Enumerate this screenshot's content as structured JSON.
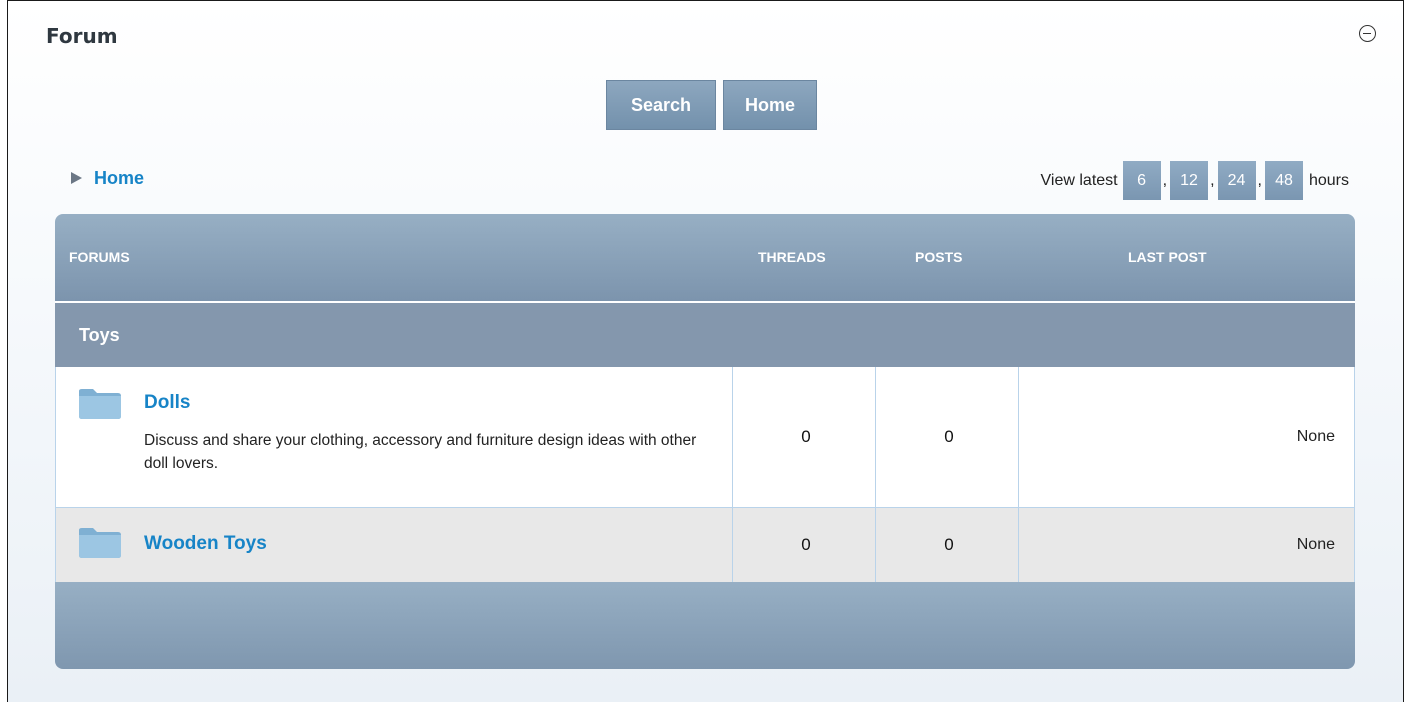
{
  "module": {
    "title": "Forum"
  },
  "nav": {
    "search_label": "Search",
    "home_label": "Home"
  },
  "breadcrumb": {
    "home": "Home"
  },
  "view_latest": {
    "label_before": "View latest",
    "label_after": "hours",
    "options": [
      "6",
      "12",
      "24",
      "48"
    ],
    "separator": ","
  },
  "table": {
    "headers": {
      "forums": "FORUMS",
      "threads": "THREADS",
      "posts": "POSTS",
      "last_post": "LAST POST"
    },
    "category": "Toys",
    "rows": [
      {
        "name": "Dolls",
        "description": "Discuss and share your clothing, accessory and furniture design ideas with other doll lovers.",
        "threads": "0",
        "posts": "0",
        "last_post": "None"
      },
      {
        "name": "Wooden Toys",
        "description": "",
        "threads": "0",
        "posts": "0",
        "last_post": "None"
      }
    ]
  },
  "colors": {
    "link": "#1784c7",
    "header": "#8da7bf",
    "category": "#8497ad",
    "alt_row": "#e8e8e8",
    "folder": "#8ab6d6"
  },
  "icons": {
    "collapse": "minus-circle-icon",
    "breadcrumb": "triangle-right-icon",
    "forum": "folder-icon"
  }
}
